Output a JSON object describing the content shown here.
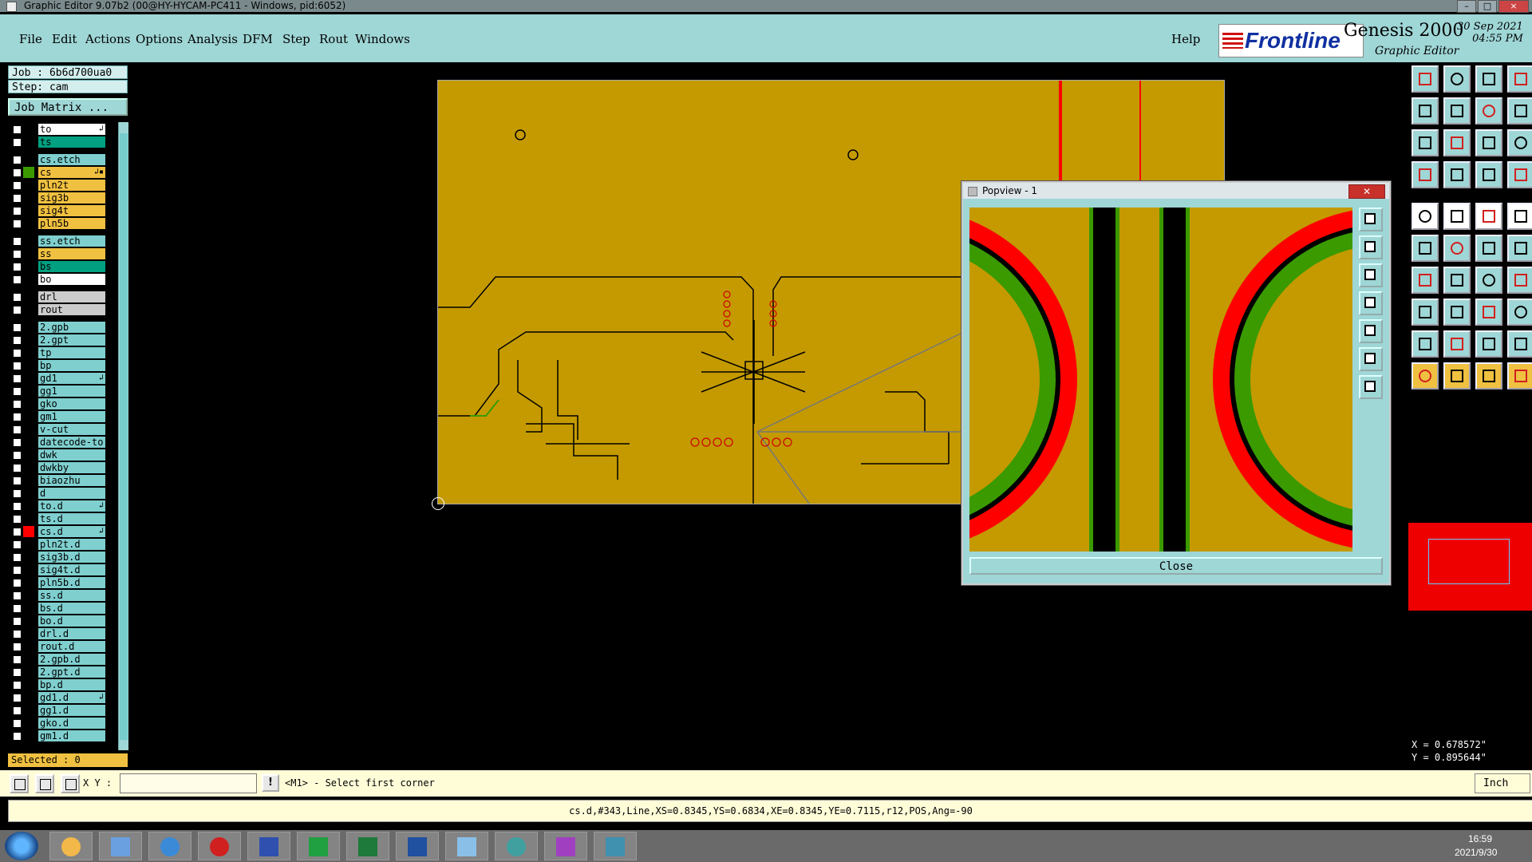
{
  "window": {
    "title": "Graphic Editor 9.07b2 (00@HY-HYCAM-PC411 - Windows, pid:6052)"
  },
  "menu": {
    "items": [
      "File",
      "Edit",
      "Actions",
      "Options",
      "Analysis",
      "DFM",
      "Step",
      "Rout",
      "Windows"
    ],
    "help": "Help"
  },
  "brand": {
    "logo": "Frontline",
    "product": "Genesis 2000",
    "subtitle": "Graphic Editor",
    "date": "30 Sep 2021",
    "time": "04:55 PM"
  },
  "info": {
    "job": "Job : 6b6d700ua0",
    "step": "Step: cam",
    "job_matrix": "Job Matrix ..."
  },
  "layers": [
    {
      "name": "to",
      "color": "#ffffff",
      "edit": "↲"
    },
    {
      "name": "ts",
      "color": "#00a080",
      "edit": ""
    },
    {
      "name": "cs.etch",
      "color": "#7fcfcf",
      "edit": ""
    },
    {
      "name": "cs",
      "color": "#f0c040",
      "edit": "↲▪"
    },
    {
      "name": "pln2t",
      "color": "#f0c040",
      "edit": ""
    },
    {
      "name": "sig3b",
      "color": "#f0c040",
      "edit": ""
    },
    {
      "name": "sig4t",
      "color": "#f0c040",
      "edit": ""
    },
    {
      "name": "pln5b",
      "color": "#f0c040",
      "edit": ""
    },
    {
      "name": "ss.etch",
      "color": "#7fcfcf",
      "edit": ""
    },
    {
      "name": "ss",
      "color": "#f0c040",
      "edit": ""
    },
    {
      "name": "bs",
      "color": "#00a080",
      "edit": ""
    },
    {
      "name": "bo",
      "color": "#ffffff",
      "edit": ""
    },
    {
      "name": "drl",
      "color": "#cccccc",
      "edit": ""
    },
    {
      "name": "rout",
      "color": "#cccccc",
      "edit": ""
    },
    {
      "name": "2.gpb",
      "color": "#7fcfcf",
      "edit": ""
    },
    {
      "name": "2.gpt",
      "color": "#7fcfcf",
      "edit": ""
    },
    {
      "name": "tp",
      "color": "#7fcfcf",
      "edit": ""
    },
    {
      "name": "bp",
      "color": "#7fcfcf",
      "edit": ""
    },
    {
      "name": "gd1",
      "color": "#7fcfcf",
      "edit": "↲"
    },
    {
      "name": "gg1",
      "color": "#7fcfcf",
      "edit": ""
    },
    {
      "name": "gko",
      "color": "#7fcfcf",
      "edit": ""
    },
    {
      "name": "gm1",
      "color": "#7fcfcf",
      "edit": ""
    },
    {
      "name": "v-cut",
      "color": "#7fcfcf",
      "edit": ""
    },
    {
      "name": "datecode-to",
      "color": "#7fcfcf",
      "edit": ""
    },
    {
      "name": "dwk",
      "color": "#7fcfcf",
      "edit": ""
    },
    {
      "name": "dwkby",
      "color": "#7fcfcf",
      "edit": ""
    },
    {
      "name": "biaozhu",
      "color": "#7fcfcf",
      "edit": ""
    },
    {
      "name": "d",
      "color": "#7fcfcf",
      "edit": ""
    },
    {
      "name": "to.d",
      "color": "#7fcfcf",
      "edit": "↲"
    },
    {
      "name": "ts.d",
      "color": "#7fcfcf",
      "edit": ""
    },
    {
      "name": "cs.d",
      "color": "#7fcfcf",
      "edit": "↲"
    },
    {
      "name": "pln2t.d",
      "color": "#7fcfcf",
      "edit": ""
    },
    {
      "name": "sig3b.d",
      "color": "#7fcfcf",
      "edit": ""
    },
    {
      "name": "sig4t.d",
      "color": "#7fcfcf",
      "edit": ""
    },
    {
      "name": "pln5b.d",
      "color": "#7fcfcf",
      "edit": ""
    },
    {
      "name": "ss.d",
      "color": "#7fcfcf",
      "edit": ""
    },
    {
      "name": "bs.d",
      "color": "#7fcfcf",
      "edit": ""
    },
    {
      "name": "bo.d",
      "color": "#7fcfcf",
      "edit": ""
    },
    {
      "name": "drl.d",
      "color": "#7fcfcf",
      "edit": ""
    },
    {
      "name": "rout.d",
      "color": "#7fcfcf",
      "edit": ""
    },
    {
      "name": "2.gpb.d",
      "color": "#7fcfcf",
      "edit": ""
    },
    {
      "name": "2.gpt.d",
      "color": "#7fcfcf",
      "edit": ""
    },
    {
      "name": "bp.d",
      "color": "#7fcfcf",
      "edit": ""
    },
    {
      "name": "gd1.d",
      "color": "#7fcfcf",
      "edit": "↲"
    },
    {
      "name": "gg1.d",
      "color": "#7fcfcf",
      "edit": ""
    },
    {
      "name": "gko.d",
      "color": "#7fcfcf",
      "edit": ""
    },
    {
      "name": "gm1.d",
      "color": "#7fcfcf",
      "edit": ""
    }
  ],
  "selected": "Selected : 0",
  "popview": {
    "title": "Popview - 1",
    "close_button": "Close"
  },
  "coords": {
    "x": "X = 0.678572\"",
    "y": "Y = 0.895644\""
  },
  "bottom": {
    "xy_label": "X Y :",
    "xy_value": "",
    "prompt": "<M1> - Select first corner",
    "units": "Inch"
  },
  "status": "cs.d,#343,Line,XS=0.8345,YS=0.6834,XE=0.8345,YE=0.7115,r12,POS,Ang=-90",
  "taskbar": {
    "time": "16:59",
    "date": "2021/9/30"
  },
  "colors": {
    "board": "#c49a00",
    "panel": "#9fd6d6",
    "highlight": "#ff0000",
    "pad_green": "#3a9a00"
  }
}
